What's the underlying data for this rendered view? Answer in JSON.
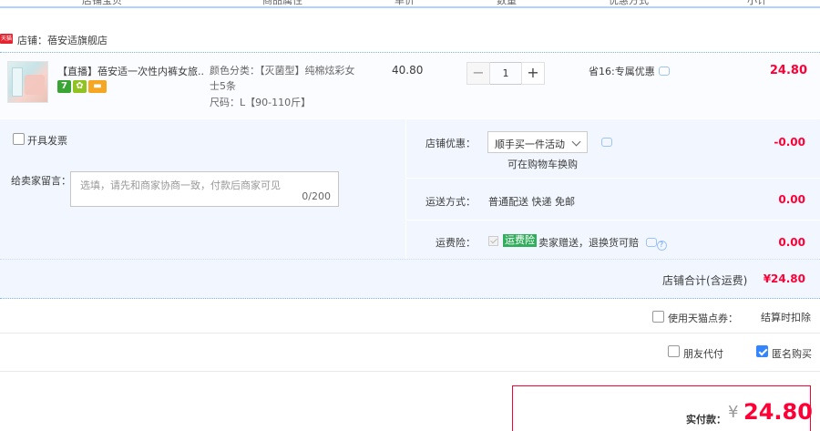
{
  "columns": [
    "店铺宝贝",
    "商品属性",
    "单价",
    "数量",
    "优惠方式",
    "小计"
  ],
  "shop": {
    "badge": "天猫",
    "name": "店铺：蓓安适旗舰店"
  },
  "item": {
    "title": "【直播】蓓安适一次性内裤女旅...",
    "icons": [
      "seven-day-icon",
      "repair-icon",
      "card-icon"
    ],
    "icon_seven": "7",
    "attr_color": "颜色分类：【灭菌型】纯棉炫彩女",
    "attr_color_2": "士5条",
    "attr_size": "尺码：L【90-110斤】",
    "price": "40.80",
    "qty": "1",
    "minus": "−",
    "plus": "+",
    "promo": "省16:专属优惠",
    "subtotal": "24.80"
  },
  "options": {
    "invoice_label": "开具发票",
    "message_label": "给卖家留言：",
    "message_placeholder": "选填，请先和商家协商一致，付款后商家可见",
    "message_count": "0/200",
    "shop_discount_label": "店铺优惠：",
    "shop_discount_value": "顺手买一件活动",
    "shop_discount_note": "可在购物车换购",
    "shop_discount_amount": "-0.00",
    "shipping_label": "运送方式：",
    "shipping_value": "普通配送 快递 免邮",
    "shipping_amount": "0.00",
    "insurance_label": "运费险：",
    "insurance_tag": "运费险",
    "insurance_text": "卖家赠送，退换货可赔",
    "insurance_help": "?",
    "insurance_amount": "0.00",
    "shop_total_label": "店铺合计(含运费)",
    "shop_total_amount": "¥24.80"
  },
  "footer": {
    "points_label": "使用天猫点券：",
    "points_note": "结算时扣除",
    "friend_pay_label": "朋友代付",
    "anonymous_label": "匿名购买",
    "anonymous_checked": true,
    "pay_label": "实付款：",
    "pay_currency": "¥",
    "pay_amount": "24.80"
  },
  "colors": {
    "accent_red": "#ff0036",
    "accent_blue": "#3385ff",
    "panel_bg": "#f2f7ff"
  }
}
